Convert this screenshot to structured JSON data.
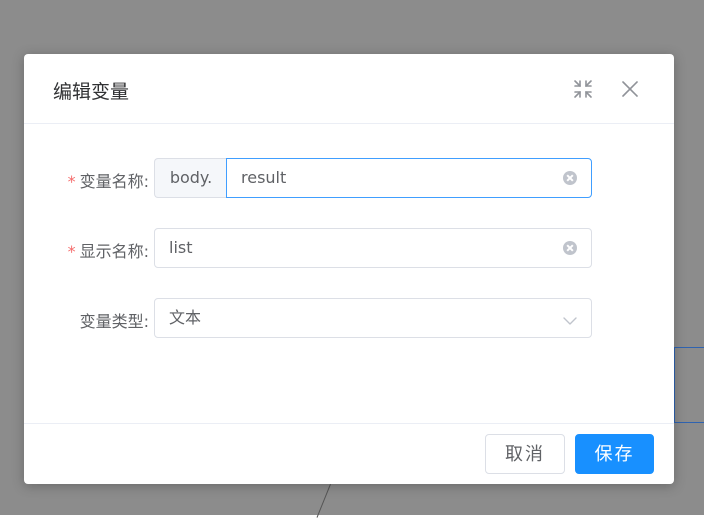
{
  "dialog": {
    "title": "编辑变量",
    "fullscreen_icon": "fullscreen-icon",
    "close_icon": "close-icon"
  },
  "form": {
    "variable_name": {
      "label": "变量名称:",
      "required": "*",
      "prefix": "body.",
      "value": "result"
    },
    "display_name": {
      "label": "显示名称:",
      "required": "*",
      "value": "list"
    },
    "variable_type": {
      "label": "变量类型:",
      "value": "文本"
    }
  },
  "footer": {
    "cancel_label": "取消",
    "save_label": "保存"
  },
  "colors": {
    "primary": "#1890ff",
    "focus_border": "#409eff",
    "required": "#f56c6c"
  }
}
